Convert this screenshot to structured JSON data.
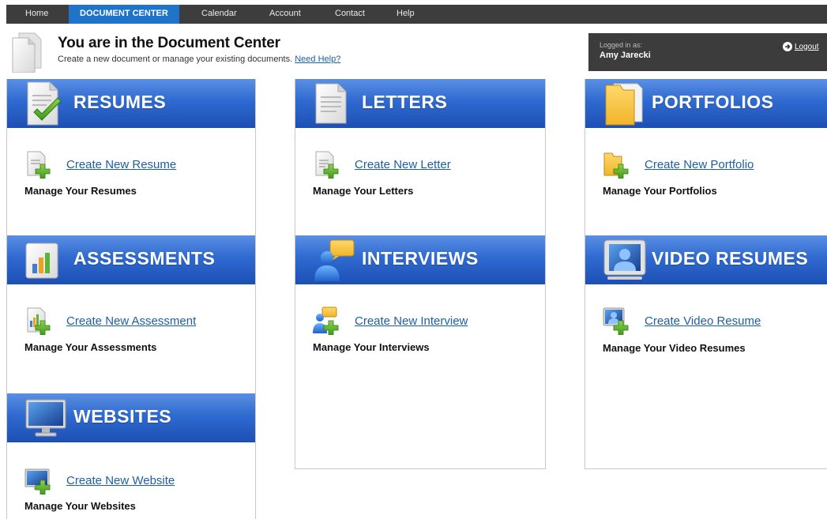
{
  "nav": {
    "items": [
      "Home",
      "DOCUMENT CENTER",
      "Calendar",
      "Account",
      "Contact",
      "Help"
    ],
    "active_index": 1
  },
  "header": {
    "title": "You are in the Document Center",
    "subtitle": "Create a new document or manage your existing documents.",
    "help_link": "Need Help?"
  },
  "login": {
    "label": "Logged in as:",
    "name": "Amy Jarecki",
    "logout": "Logout"
  },
  "colors": {
    "band_top": "#5a8fe3",
    "band_bottom": "#1d4fb4",
    "nav_bg": "#3d3d3d",
    "nav_active": "#1f74c9",
    "link": "#1c5fa8"
  },
  "sections": {
    "resumes": {
      "title": "RESUMES",
      "icon": "resume-check-icon",
      "create": "Create New Resume",
      "manage": "Manage Your Resumes"
    },
    "letters": {
      "title": "LETTERS",
      "icon": "letter-icon",
      "create": "Create New Letter",
      "manage": "Manage Your Letters"
    },
    "portfolios": {
      "title": "PORTFOLIOS",
      "icon": "folder-icon",
      "create": "Create New Portfolio",
      "manage": "Manage Your Portfolios"
    },
    "assessments": {
      "title": "ASSESSMENTS",
      "icon": "bar-chart-icon",
      "create": "Create New Assessment",
      "manage": "Manage Your Assessments"
    },
    "interviews": {
      "title": "INTERVIEWS",
      "icon": "person-chat-icon",
      "create": "Create New Interview",
      "manage": "Manage Your Interviews"
    },
    "video_resumes": {
      "title": "VIDEO RESUMES",
      "icon": "video-person-icon",
      "create": "Create Video Resume",
      "manage": "Manage Your Video Resumes"
    },
    "websites": {
      "title": "WEBSITES",
      "icon": "monitor-icon",
      "create": "Create New Website",
      "manage": "Manage Your Websites"
    }
  }
}
